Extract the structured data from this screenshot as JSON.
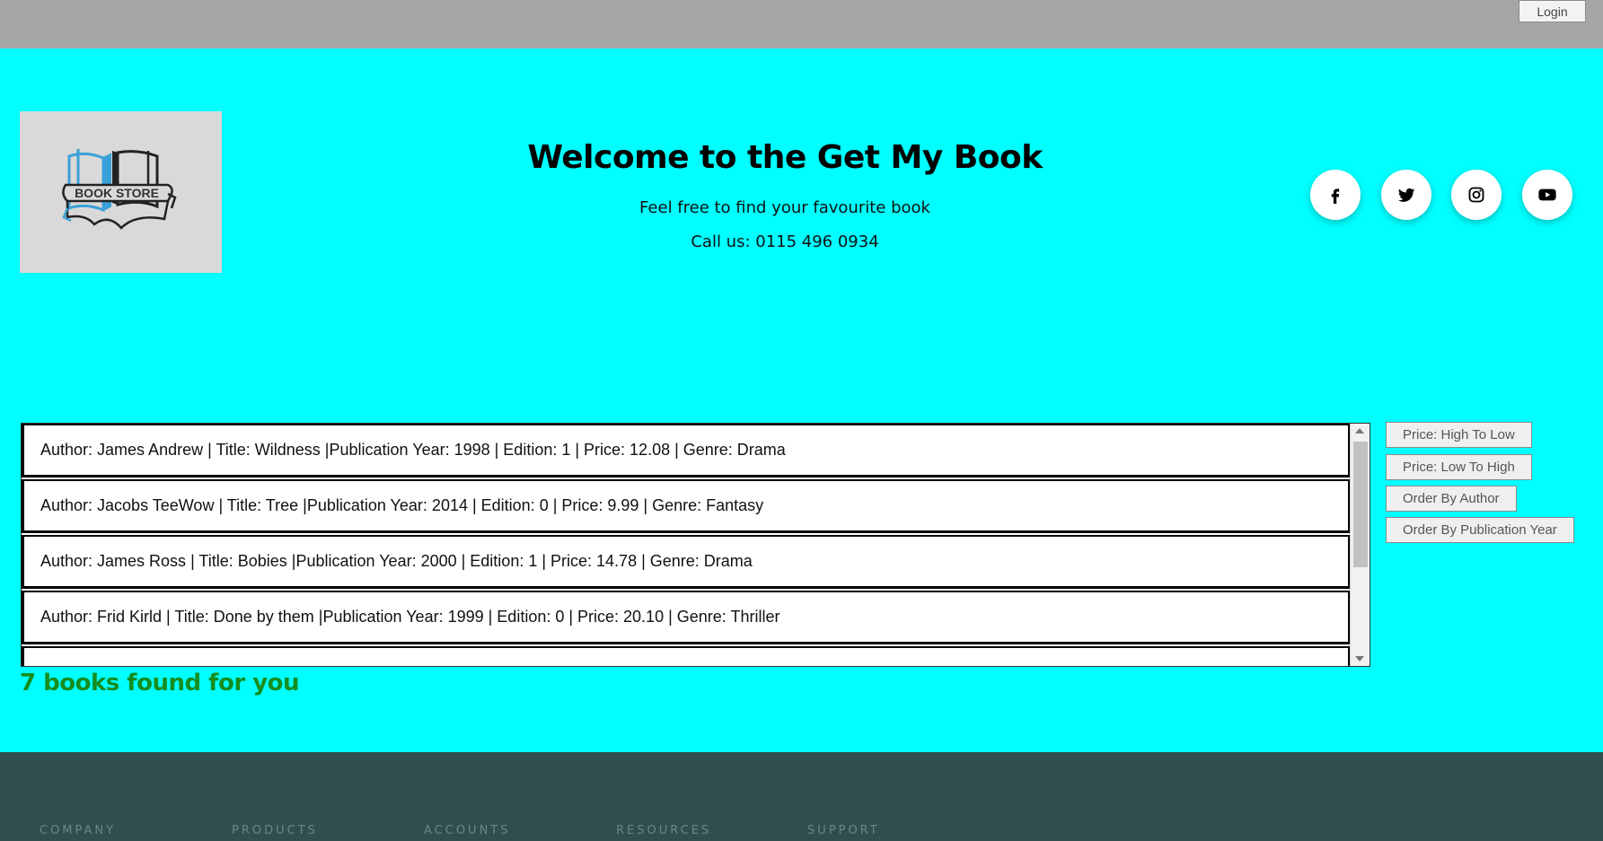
{
  "header": {
    "login_label": "Login"
  },
  "hero": {
    "logo_text": "BOOK STORE",
    "title": "Welcome to the Get My Book",
    "subtitle": "Feel free to find your favourite book",
    "phone": "Call us: 0115 496 0934"
  },
  "social": [
    {
      "icon": "facebook-icon"
    },
    {
      "icon": "twitter-icon"
    },
    {
      "icon": "instagram-icon"
    },
    {
      "icon": "youtube-icon"
    }
  ],
  "books": [
    "Author: James Andrew | Title: Wildness |Publication Year: 1998 | Edition: 1 | Price: 12.08 | Genre: Drama",
    "Author: Jacobs TeeWow | Title: Tree |Publication Year: 2014 | Edition: 0 | Price: 9.99 | Genre: Fantasy",
    "Author: James Ross | Title: Bobies |Publication Year: 2000 | Edition: 1 | Price: 14.78 | Genre: Drama",
    "Author: Frid Kirld | Title: Done by them |Publication Year: 1999 | Edition: 0 | Price: 20.10 | Genre: Thriller"
  ],
  "sort_buttons": {
    "high_to_low": "Price: High To Low",
    "low_to_high": "Price: Low To High",
    "by_author": "Order By Author",
    "by_year": "Order By Publication Year"
  },
  "result_text": "7 books found for you",
  "footer": {
    "columns": [
      "COMPANY",
      "PRODUCTS",
      "ACCOUNTS",
      "RESOURCES",
      "SUPPORT"
    ]
  },
  "colors": {
    "background": "#00ffff",
    "topbar": "#a6a6a6",
    "footer": "#2f4f4f",
    "result_text": "#168d1f",
    "logo_blue": "#3aa0d8"
  }
}
